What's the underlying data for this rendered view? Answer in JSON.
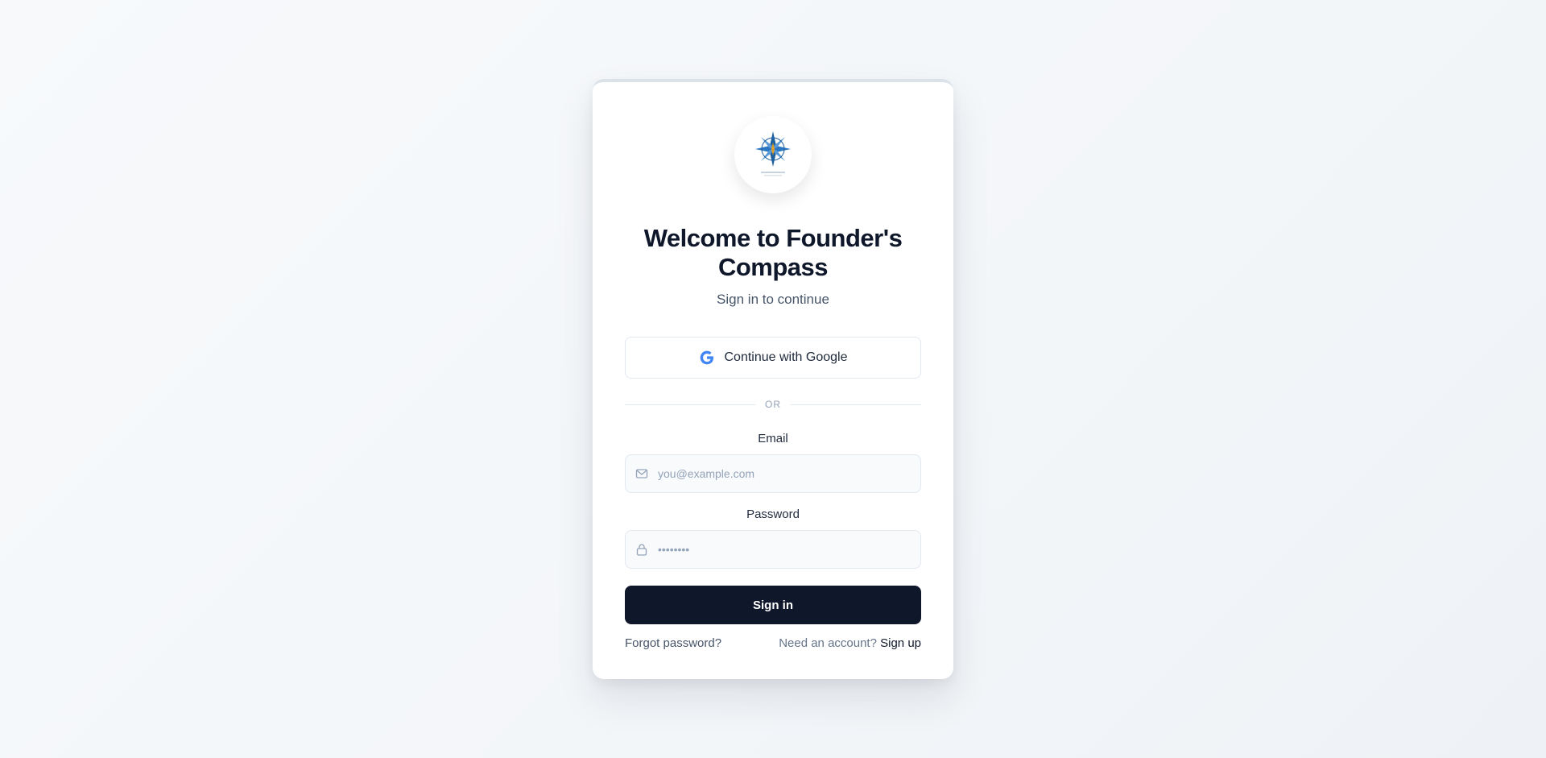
{
  "logo": {
    "icon": "compass-rose-icon"
  },
  "header": {
    "title": "Welcome to Founder's Compass",
    "subtitle": "Sign in to continue"
  },
  "google_button": {
    "label": "Continue with Google",
    "icon": "google-icon"
  },
  "divider": {
    "text": "OR"
  },
  "email": {
    "label": "Email",
    "placeholder": "you@example.com",
    "icon": "mail-icon"
  },
  "password": {
    "label": "Password",
    "placeholder": "••••••••",
    "icon": "lock-icon"
  },
  "signin_button": {
    "label": "Sign in"
  },
  "footer": {
    "forgot_label": "Forgot password?",
    "need_account": "Need an account?",
    "signup_label": "Sign up"
  },
  "colors": {
    "primary": "#0f172a",
    "muted": "#475569",
    "border": "#e2e8f0",
    "google_blue": "#4285F4",
    "logo_blue": "#1e5f9e",
    "logo_gold": "#e3a126"
  }
}
